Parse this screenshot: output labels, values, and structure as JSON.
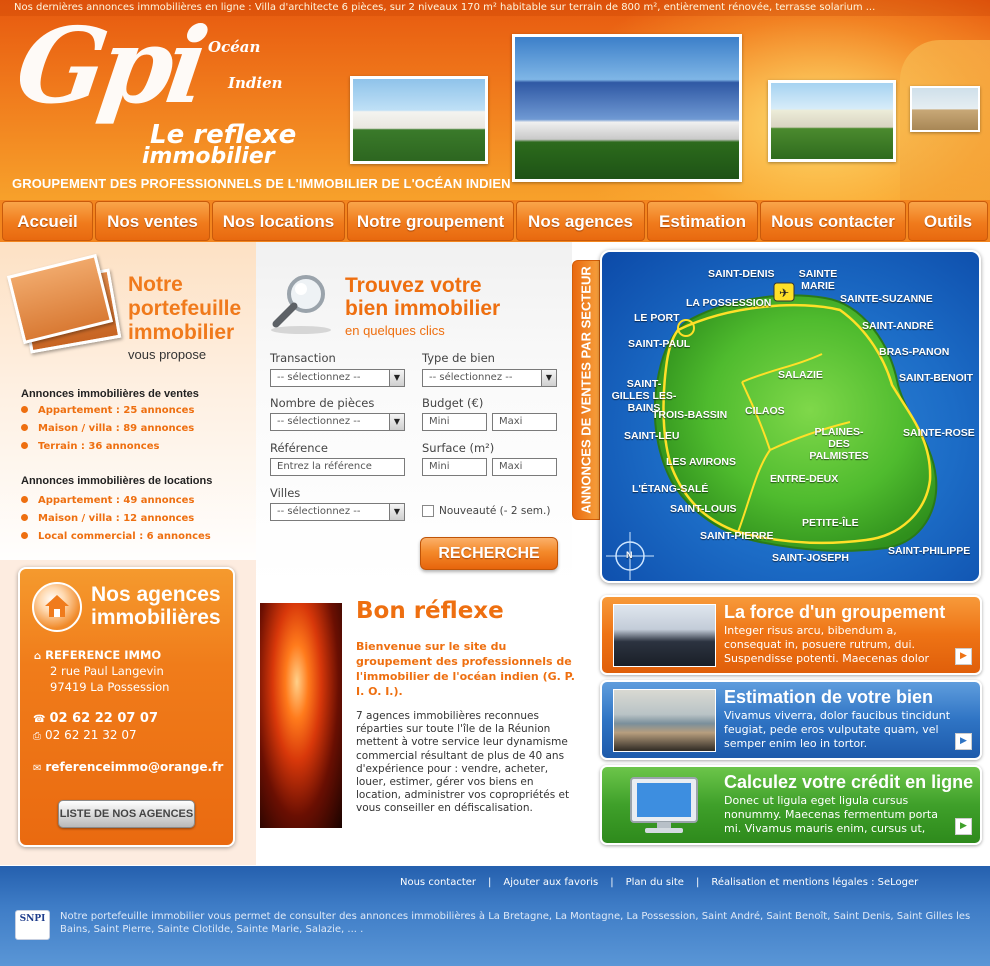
{
  "header": {
    "ticker": "Nos dernières annonces immobilières en ligne : Villa d'architecte 6 pièces, sur 2 niveaux 170 m² habitable sur terrain de 800 m², entièrement rénovée, terrasse solarium ...",
    "logo": "Gpi",
    "logo_ocean": "Océan",
    "logo_indien": "Indien",
    "tagline_line1": "Le reflexe",
    "tagline_line2": "immobilier",
    "subtitle": "GROUPEMENT DES PROFESSIONNELS DE L'IMMOBILIER DE L'OCÉAN INDIEN"
  },
  "nav": [
    "Accueil",
    "Nos ventes",
    "Nos locations",
    "Notre groupement",
    "Nos agences",
    "Estimation",
    "Nous contacter",
    "Outils"
  ],
  "portfolio": {
    "title_1": "Notre",
    "title_2": "portefeuille",
    "title_3": "immobilier",
    "subtitle": "vous propose",
    "ventes_heading": "Annonces immobilières de ventes",
    "ventes": [
      "Appartement : 25 annonces",
      "Maison / villa : 89 annonces",
      "Terrain : 36 annonces"
    ],
    "locations_heading": "Annonces immobilières de locations",
    "locations": [
      "Appartement : 49 annonces",
      "Maison / villa : 12 annonces",
      "Local commercial : 6 annonces"
    ]
  },
  "agencies": {
    "title_1": "Nos agences",
    "title_2": "immobilières",
    "name": "REFERENCE IMMO",
    "address_1": "2 rue Paul Langevin",
    "address_2": "97419 La Possession",
    "phone": "02 62 22 07 07",
    "fax": "02 62 21 32 07",
    "email": "referenceimmo@orange.fr",
    "button": "LISTE DE NOS AGENCES"
  },
  "search": {
    "title_1": "Trouvez votre",
    "title_2": "bien immobilier",
    "subtitle": "en quelques clics",
    "transaction_label": "Transaction",
    "transaction_value": "-- sélectionnez --",
    "type_label": "Type de bien",
    "type_value": "-- sélectionnez --",
    "pieces_label": "Nombre de pièces",
    "pieces_value": "-- sélectionnez --",
    "budget_label": "Budget (€)",
    "budget_min": "Mini",
    "budget_max": "Maxi",
    "reference_label": "Référence",
    "reference_placeholder": "Entrez la référence",
    "surface_label": "Surface (m²)",
    "surface_min": "Mini",
    "surface_max": "Maxi",
    "villes_label": "Villes",
    "villes_value": "-- sélectionnez --",
    "nouveaute_label": "Nouveauté (- 2 sem.)",
    "button": "RECHERCHE"
  },
  "map": {
    "tab_label": "ANNONCES DE VENTES PAR SECTEUR",
    "towns": [
      "SAINT-DENIS",
      "SAINTE MARIE",
      "SAINTE-SUZANNE",
      "LA POSSESSION",
      "LE PORT",
      "SAINT-ANDRÉ",
      "SAINT-PAUL",
      "BRAS-PANON",
      "SALAZIE",
      "SAINT-BENOIT",
      "SAINT-GILLES LES-BAINS",
      "TROIS-BASSIN",
      "CILAOS",
      "PLAINES-DES PALMISTES",
      "SAINTE-ROSE",
      "SAINT-LEU",
      "LES AVIRONS",
      "ENTRE-DEUX",
      "L'ÉTANG-SALÉ",
      "SAINT-LOUIS",
      "PETITE-ÎLE",
      "SAINT-PIERRE",
      "SAINT-JOSEPH",
      "SAINT-PHILIPPE"
    ],
    "compass": "N"
  },
  "intro": {
    "title": "Bon réflexe",
    "lead": "Bienvenue sur le site du groupement des professionnels de l'immobilier de l'océan indien (G. P. I. O. I.).",
    "body": "7 agences immobilières reconnues réparties sur toute l'île de la Réunion mettent à votre service leur dynamisme commercial résultant de plus de 40 ans d'expérience pour : vendre, acheter, louer, estimer, gérer vos biens en location, administrer vos copropriétés et vous conseiller en défiscalisation."
  },
  "promos": [
    {
      "title": "La force d'un groupement",
      "text": "Integer risus arcu, bibendum a, consequat in, posuere rutrum, dui. Suspendisse potenti. Maecenas dolor"
    },
    {
      "title": "Estimation de votre bien",
      "text": "Vivamus viverra, dolor faucibus tincidunt feugiat, pede eros vulputate quam, vel semper enim leo in tortor."
    },
    {
      "title": "Calculez votre crédit en ligne",
      "text": "Donec ut ligula eget ligula cursus nonummy. Maecenas fermentum porta mi. Vivamus mauris enim, cursus ut,"
    }
  ],
  "footer": {
    "links": [
      "Nous contacter",
      "Ajouter aux favoris",
      "Plan du site",
      "Réalisation et mentions légales : SeLoger"
    ],
    "snpi": "SNPI",
    "text": "Notre portefeuille immobilier vous permet de consulter des annonces immobilières à  La Bretagne, La Montagne, La Possession, Saint André, Saint Benoît, Saint Denis, Saint Gilles les Bains, Saint Pierre, Sainte Clotilde, Sainte Marie, Salazie, ... ."
  },
  "colors": {
    "accent_orange": "#ee6f10",
    "nav_orange": "#f07b1c",
    "map_blue": "#1c6cc6",
    "island_green": "#4fbb2e",
    "footer_blue": "#3e7cc6",
    "promo_orange": "#f07c1a",
    "promo_blue": "#2f74c4",
    "promo_green": "#3fa02a"
  }
}
